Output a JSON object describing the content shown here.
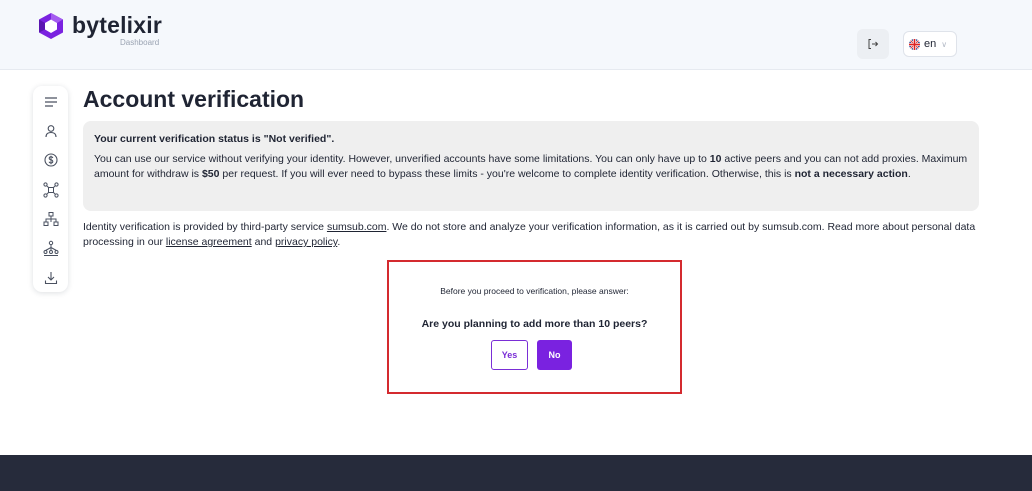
{
  "header": {
    "brand_name": "bytelixir",
    "brand_sub": "Dashboard",
    "language": "en"
  },
  "sidebar": {
    "items": [
      {
        "icon": "menu-icon"
      },
      {
        "icon": "user-icon"
      },
      {
        "icon": "dollar-icon"
      },
      {
        "icon": "peers-network-icon"
      },
      {
        "icon": "proxy-hierarchy-icon"
      },
      {
        "icon": "referral-icon"
      },
      {
        "icon": "download-icon"
      }
    ]
  },
  "page": {
    "title": "Account verification"
  },
  "status": {
    "title": "Your current verification status is \"Not verified\".",
    "body": {
      "t1": "You can use our service without verifying your identity. However, unverified accounts have some limitations. You can only have up to ",
      "peers_limit": "10",
      "t2": " active peers and you can not add proxies. Maximum amount for withdraw is ",
      "withdraw_limit": "$50",
      "t3": " per request. If you will ever need to bypass these limits - you're welcome to complete identity verification. Otherwise, this is ",
      "emphasis": "not a necessary action",
      "t4": "."
    }
  },
  "info": {
    "t1": "Identity verification is provided by third-party service ",
    "link_sumsub": "sumsub.com",
    "t2": ". We do not store and analyze your verification information, as it is carried out by sumsub.com. Read more about personal data processing in our ",
    "link_license": "license agreement",
    "t3": " and ",
    "link_privacy": "privacy policy",
    "t4": "."
  },
  "question": {
    "intro": "Before you proceed to verification, please answer:",
    "title": "Are you planning to add more than 10 peers?",
    "yes_label": "Yes",
    "no_label": "No"
  },
  "colors": {
    "accent": "#7a22e0",
    "highlight_border": "#d42a2f",
    "footer": "#262b3b",
    "header_bg": "#f5f8fc"
  }
}
